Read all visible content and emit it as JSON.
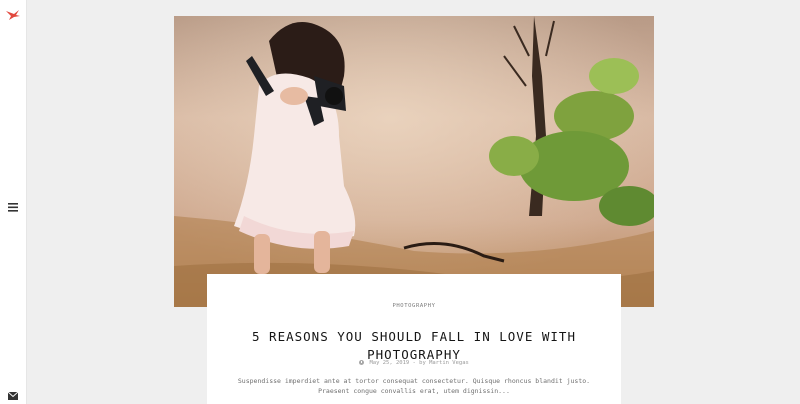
{
  "sidebar": {
    "logo_icon": "bird-logo-icon",
    "menu_icon": "hamburger-menu-icon",
    "mail_icon": "envelope-icon",
    "accent_color": "#e2483d"
  },
  "post": {
    "category": "PHOTOGRAPHY",
    "title": "5 REASONS YOU SHOULD FALL IN LOVE WITH PHOTOGRAPHY",
    "date": "May 25, 2019",
    "byline": "- by Martin Vegas",
    "excerpt": "Suspendisse imperdiet ante at tortor consequat consectetur. Quisque rhoncus blandit justo. Praesent congue convallis erat, utem dignissin..."
  }
}
